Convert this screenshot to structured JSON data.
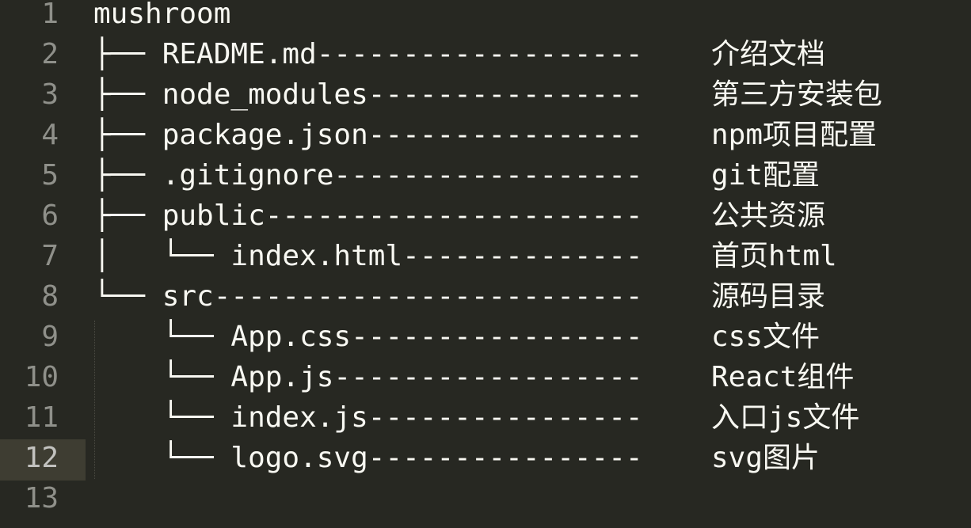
{
  "editor": {
    "lines": [
      {
        "num": "1",
        "code": "mushroom",
        "desc": ""
      },
      {
        "num": "2",
        "code": "├── README.md-------------------",
        "desc": "介绍文档"
      },
      {
        "num": "3",
        "code": "├── node_modules----------------",
        "desc": "第三方安装包"
      },
      {
        "num": "4",
        "code": "├── package.json----------------",
        "desc": "npm项目配置"
      },
      {
        "num": "5",
        "code": "├── .gitignore------------------",
        "desc": "git配置"
      },
      {
        "num": "6",
        "code": "├── public----------------------",
        "desc": "公共资源"
      },
      {
        "num": "7",
        "code": "│   └── index.html--------------",
        "desc": "首页html"
      },
      {
        "num": "8",
        "code": "└── src-------------------------",
        "desc": "源码目录"
      },
      {
        "num": "9",
        "code": "    └── App.css-----------------",
        "desc": "css文件"
      },
      {
        "num": "10",
        "code": "    └── App.js------------------",
        "desc": "React组件"
      },
      {
        "num": "11",
        "code": "    └── index.js----------------",
        "desc": "入口js文件"
      },
      {
        "num": "12",
        "code": "    └── logo.svg----------------",
        "desc": "svg图片"
      },
      {
        "num": "13",
        "code": "",
        "desc": ""
      }
    ]
  }
}
